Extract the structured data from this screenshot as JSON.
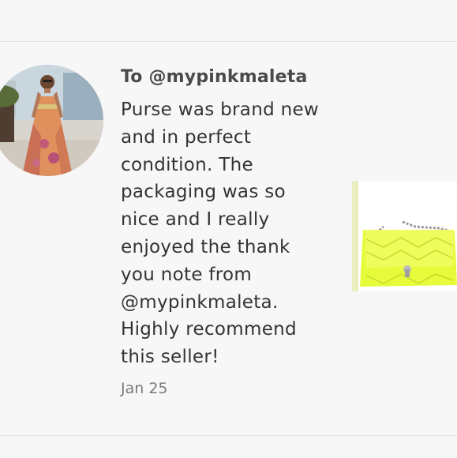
{
  "review": {
    "recipient": "To @mypinkmaleta",
    "text": "Purse was brand new\nand in perfect\ncondition. The\npackaging was so\nnice and I really\nenjoyed the thank\nyou note from\n@mypinkmaleta.\nHighly recommend\nthis seller!",
    "date": "Jan 25"
  },
  "avatar": {
    "icon": "reviewer-avatar-photo"
  },
  "product": {
    "icon": "neon-yellow-quilted-chain-purse",
    "color": "#e6fb3a"
  },
  "colors": {
    "background": "#f7f7f8",
    "divider": "#e4e4e6",
    "recipient_text": "#4a4a4a",
    "body_text": "#333333",
    "date_text": "#7a7a7a"
  }
}
